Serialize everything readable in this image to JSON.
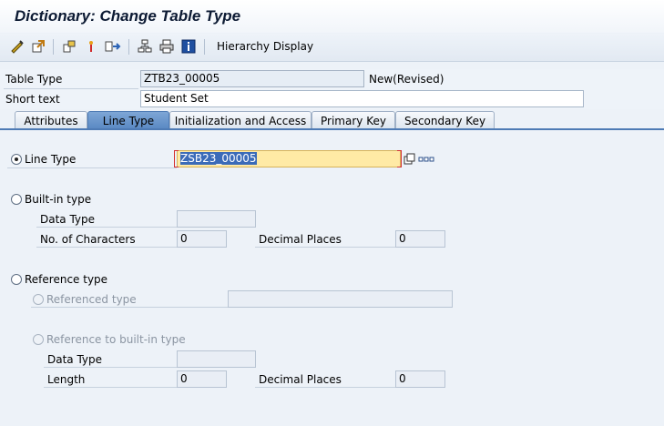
{
  "window": {
    "title": "Dictionary: Change Table Type"
  },
  "toolbar": {
    "icons": [
      "other-object-icon",
      "display-change-icon",
      "check-icon",
      "activate-icon",
      "where-used-icon",
      "hierarchy-icon",
      "print-icon",
      "info-icon"
    ],
    "hierarchy_label": "Hierarchy Display"
  },
  "header": {
    "table_type_label": "Table Type",
    "table_type_value": "ZTB23_00005",
    "status": "New(Revised)",
    "short_text_label": "Short text",
    "short_text_value": "Student Set"
  },
  "tabs": [
    {
      "label": "Attributes",
      "active": false
    },
    {
      "label": "Line Type",
      "active": true
    },
    {
      "label": "Initialization and Access",
      "active": false
    },
    {
      "label": "Primary Key",
      "active": false
    },
    {
      "label": "Secondary Key",
      "active": false
    }
  ],
  "line_type": {
    "label": "Line Type",
    "value": "ZSB23_00005",
    "selected": true
  },
  "builtin": {
    "label": "Built-in type",
    "data_type_label": "Data Type",
    "data_type_value": "",
    "chars_label": "No. of Characters",
    "chars_value": "0",
    "decimals_label": "Decimal Places",
    "decimals_value": "0"
  },
  "reference": {
    "label": "Reference type",
    "referenced_label": "Referenced type",
    "referenced_value": "",
    "ref_builtin_label": "Reference to built-in type",
    "data_type_label": "Data Type",
    "data_type_value": "",
    "length_label": "Length",
    "length_value": "0",
    "decimals_label": "Decimal Places",
    "decimals_value": "0"
  },
  "colors": {
    "accent": "#5b8ac4",
    "highlight": "#ffeaa5",
    "selection": "#3b6bb8"
  }
}
